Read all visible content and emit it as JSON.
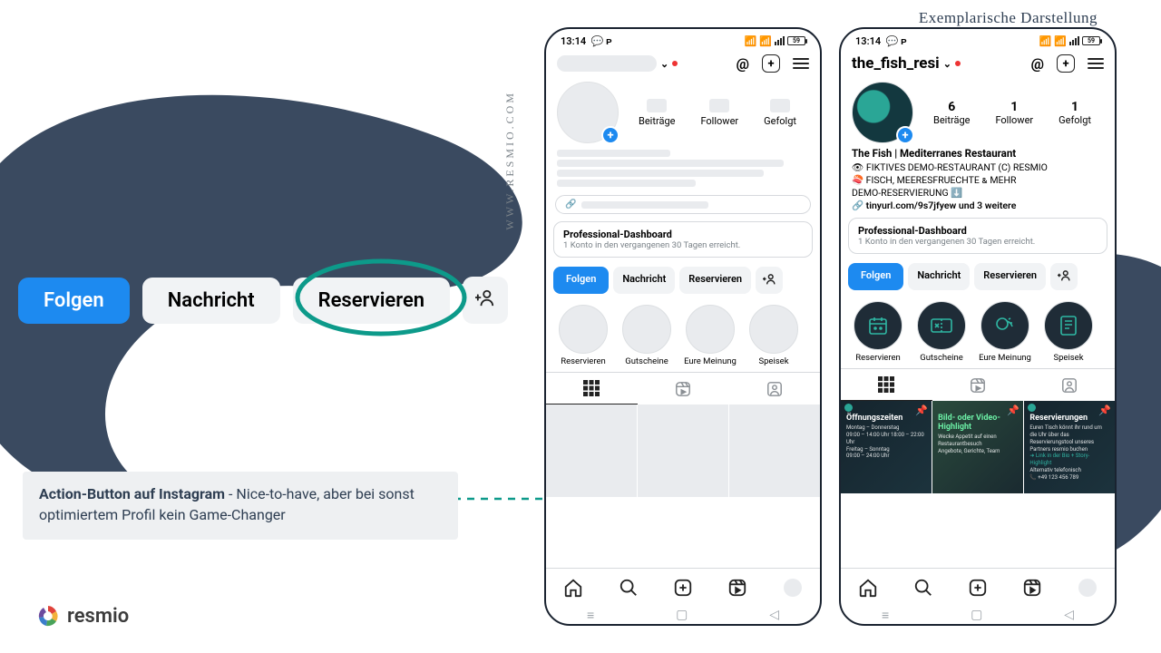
{
  "caption_top": "Exemplarische Darstellung",
  "side_url": "WWW.RESMIO.COM",
  "logo_text": "resmio",
  "annotation": {
    "bold": "Action-Button auf Instagram",
    "rest": " - Nice-to-have, aber bei sonst optimiertem Profil kein Game-Changer"
  },
  "big_buttons": {
    "follow": "Folgen",
    "message": "Nachricht",
    "reserve": "Reservieren",
    "add_user": "+"
  },
  "statusbar": {
    "time": "13:14",
    "battery": "59"
  },
  "stats_labels": {
    "posts": "Beiträge",
    "followers": "Follower",
    "following": "Gefolgt"
  },
  "dashboard": {
    "title": "Professional-Dashboard",
    "sub": "1 Konto in den vergangenen 30 Tagen erreicht."
  },
  "action_row": {
    "follow": "Folgen",
    "message": "Nachricht",
    "reserve": "Reservieren"
  },
  "highlights": [
    "Reservieren",
    "Gutscheine",
    "Eure Meinung",
    "Speisek"
  ],
  "right_phone": {
    "username": "the_fish_resi",
    "stats": {
      "posts": "6",
      "followers": "1",
      "following": "1"
    },
    "bio_name": "The Fish | Mediterranes Restaurant",
    "bio_line1": "👁 FIKTIVES DEMO-RESTAURANT (C) RESMIO",
    "bio_line2": "🍣 FISCH, MEERESFRUECHTE & MEHR",
    "bio_line3": "DEMO-RESERVIERUNG ⬇️",
    "bio_link": "🔗 tinyurl.com/9s7jfyew und 3 weitere",
    "posts": [
      {
        "title": "Öffnungszeiten",
        "l1": "Montag – Donnerstag",
        "l2": "09:00 – 14:00 Uhr   18:00 – 22:00 Uhr",
        "l3": "Freitag – Sonntag",
        "l4": "09:00 – 24:00 Uhr"
      },
      {
        "title": "Bild- oder Video-Highlight",
        "l1": "Wecke Appetit auf einen Restaurantbesuch",
        "l2": "Angebote, Gerichte, Team"
      },
      {
        "title": "Reservierungen",
        "l1": "Euren Tisch könnt ihr rund um die Uhr über das Reservierungstool unseres Partners resmio buchen",
        "l2": "➜ Link in der Bio + Story-Highlight",
        "l3": "Alternativ telefonisch",
        "l4": "📞 +49 123 456 789"
      }
    ]
  }
}
